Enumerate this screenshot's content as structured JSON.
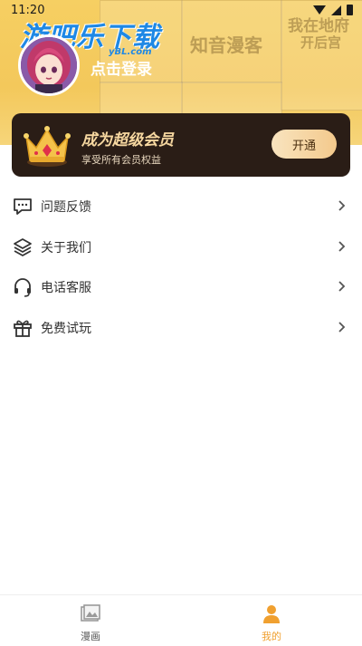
{
  "status_bar": {
    "time": "11:20"
  },
  "watermark": {
    "title": "游吧乐下载",
    "sub": "yBL.com"
  },
  "header": {
    "bg_text_1": "知音漫客",
    "bg_text_2": "我在地府",
    "bg_text_3": "开后宫"
  },
  "profile": {
    "login_label": "点击登录"
  },
  "vip": {
    "title": "成为超级会员",
    "subtitle": "享受所有会员权益",
    "button_label": "开通",
    "bg_color": "#2a1d16",
    "accent_color": "#f6d7a0"
  },
  "menu": {
    "items": [
      {
        "label": "问题反馈",
        "icon": "message-icon"
      },
      {
        "label": "关于我们",
        "icon": "layers-icon"
      },
      {
        "label": "电话客服",
        "icon": "headset-icon"
      },
      {
        "label": "免费试玩",
        "icon": "gift-icon"
      }
    ]
  },
  "tabbar": {
    "tabs": [
      {
        "label": "漫画",
        "icon": "comic-icon",
        "active": false
      },
      {
        "label": "我的",
        "icon": "person-icon",
        "active": true
      }
    ],
    "active_color": "#f0a030",
    "inactive_color": "#555555"
  }
}
